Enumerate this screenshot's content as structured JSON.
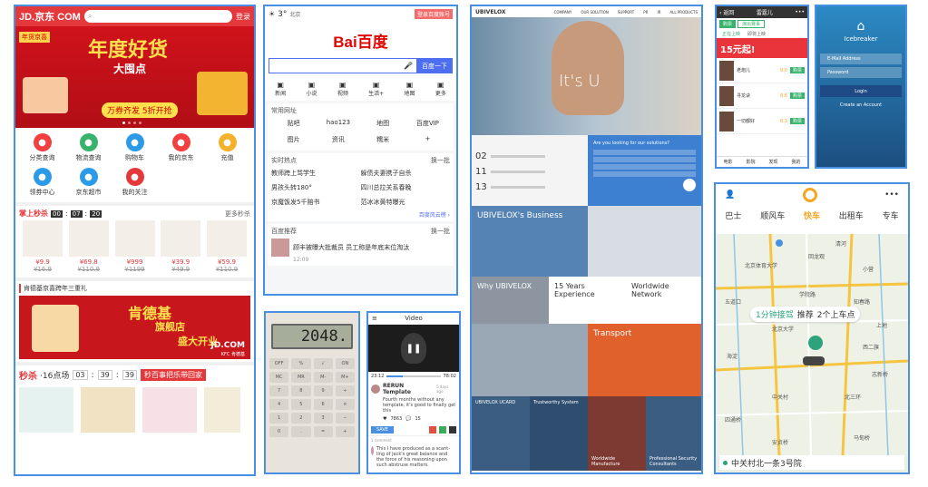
{
  "jd": {
    "logo": "JD.京东 COM",
    "login": "登录",
    "banner_tag": "年货京喜",
    "banner_title": "年度好货",
    "banner_sub": "大囤点",
    "banner_promo": "万券齐发 5折开抢",
    "icons": [
      {
        "label": "分类查询",
        "color": "#f23f3f"
      },
      {
        "label": "物流查询",
        "color": "#38b36b"
      },
      {
        "label": "购物车",
        "color": "#2b9be8"
      },
      {
        "label": "我的京东",
        "color": "#f23f3f"
      },
      {
        "label": "充值",
        "color": "#f6b12a"
      },
      {
        "label": "领券中心",
        "color": "#2b9be8"
      },
      {
        "label": "京东超市",
        "color": "#2b9be8"
      },
      {
        "label": "我的关注",
        "color": "#e4393c"
      }
    ],
    "flash_title": "掌上秒杀",
    "flash_timer": [
      "00",
      "07",
      "20"
    ],
    "flash_more": "更多秒杀",
    "products": [
      {
        "price": "¥9.9",
        "old": "¥16.9"
      },
      {
        "price": "¥69.8",
        "old": "¥110.9"
      },
      {
        "price": "¥999",
        "old": "¥1199"
      },
      {
        "price": "¥39.9",
        "old": "¥49.9"
      },
      {
        "price": "¥59.9",
        "old": "¥110.9"
      }
    ],
    "kfc_title": "肯德基京喜跨年三重礼",
    "kfc_banner_1": "肯德基",
    "kfc_banner_2": "旗舰店",
    "kfc_banner_3": "盛大开业",
    "kfc_logo": "JD.COM",
    "kfc_sub": "KFC 肯德基",
    "seckill_title": "秒杀",
    "seckill_time": "·16点场",
    "seckill_timer": [
      "03",
      "39",
      "39"
    ],
    "seckill_banner": "秒百事把乐带回家"
  },
  "baidu": {
    "weather": "3°",
    "city": "北京",
    "login_btn": "登录百度账号",
    "logo": "Bai百度",
    "search_btn": "百度一下",
    "nav": [
      "新闻",
      "小说",
      "视频",
      "生活+",
      "地图",
      "更多"
    ],
    "common_title": "常用网址",
    "common": [
      "贴吧",
      "hao123",
      "地图",
      "百度VIP",
      "图片",
      "资讯",
      "糯米",
      "+"
    ],
    "hot_title": "实时热点",
    "hot_refresh": "换一批",
    "hot": [
      "教师跨上骂学生",
      "躲债夫妻携子自杀",
      "男孩头转180°",
      "四川总拉关系春晚",
      "京魔饭发5千赔书",
      "范冰冰黄特曝光"
    ],
    "hot_more": "百度风云榜 ›",
    "rec_title": "百度推荐",
    "rec_refresh": "换一批",
    "rec_news": "顾丰被曝大批裁员 员工称是年底末位淘汰",
    "rec_time": "12:09"
  },
  "calc": {
    "display": "2048.",
    "keys": [
      "OFF",
      "%",
      "√",
      "ON",
      "MC",
      "MR",
      "M-",
      "M+",
      "7",
      "8",
      "9",
      "÷",
      "4",
      "5",
      "6",
      "×",
      "1",
      "2",
      "3",
      "−",
      "0",
      ".",
      "=",
      "+"
    ]
  },
  "video": {
    "title": "Video",
    "time_start": "23:12",
    "time_end": "78:02",
    "post_title": "RERUN Template",
    "post_time": "5 days ago",
    "post_text": "Fourth months without any template, it's good to finally get this",
    "likes": "7863",
    "comments": "15",
    "save": "SAVE",
    "comment_meta": "1 comment",
    "comment_text": "This I have produced as a scant-ling of Jack's great balance and the force of his reasoning upon such abstruse matters."
  },
  "ubi": {
    "logo": "UBIVELOX",
    "nav": [
      "COMPANY",
      "OUR SOLUTION",
      "SUPPORT",
      "PR",
      "IR",
      "ALL PRODUCTS"
    ],
    "hero_text": "It's U",
    "dates": [
      "02",
      "11",
      "13"
    ],
    "solution_q": "Are you looking for our solutions?",
    "business": "UBIVELOX's Business",
    "why": "Why UBIVELOX",
    "years": "15 Years Experience",
    "network": "Worldwide Network",
    "transport": "Transport",
    "ucard": "UBIVELOX UCARD",
    "trust": "Trustworthy System",
    "manufacture": "Worldwide Manufacture",
    "security": "Professional Security Consultants"
  },
  "movie": {
    "back": "‹ 返回",
    "title": "雷霆儿",
    "tabs": [
      "购票",
      "演出赛事"
    ],
    "filters": [
      "正在上映",
      "即将上映"
    ],
    "promo": "15元起!",
    "rows": [
      {
        "name": "老炮儿",
        "score": "9.0",
        "btn": "购票"
      },
      {
        "name": "寻龙诀",
        "score": "8.6",
        "btn": "购票"
      },
      {
        "name": "一切都好",
        "score": "8.3",
        "btn": "购票"
      }
    ],
    "bottom": [
      "电影",
      "影院",
      "发现",
      "我的"
    ]
  },
  "ice": {
    "title": "Icebreaker",
    "email": "E-Mail Address",
    "password": "Password",
    "login": "Login",
    "create": "Create an Account"
  },
  "didi": {
    "tabs": [
      "巴士",
      "顺风车",
      "快车",
      "出租车",
      "专车"
    ],
    "bubble_a": "1分钟接驾",
    "bubble_b": "推荐",
    "bubble_c": "2个上车点",
    "places": [
      "北京体育大学",
      "清河",
      "小营",
      "五道口",
      "学院路",
      "知春路",
      "北京大学",
      "上地",
      "西二旗",
      "海淀",
      "中关村",
      "四通桥",
      "北三环",
      "回龙观",
      "志新桥",
      "马甸桥",
      "安贞桥"
    ],
    "address": "中关村北一条3号院"
  }
}
